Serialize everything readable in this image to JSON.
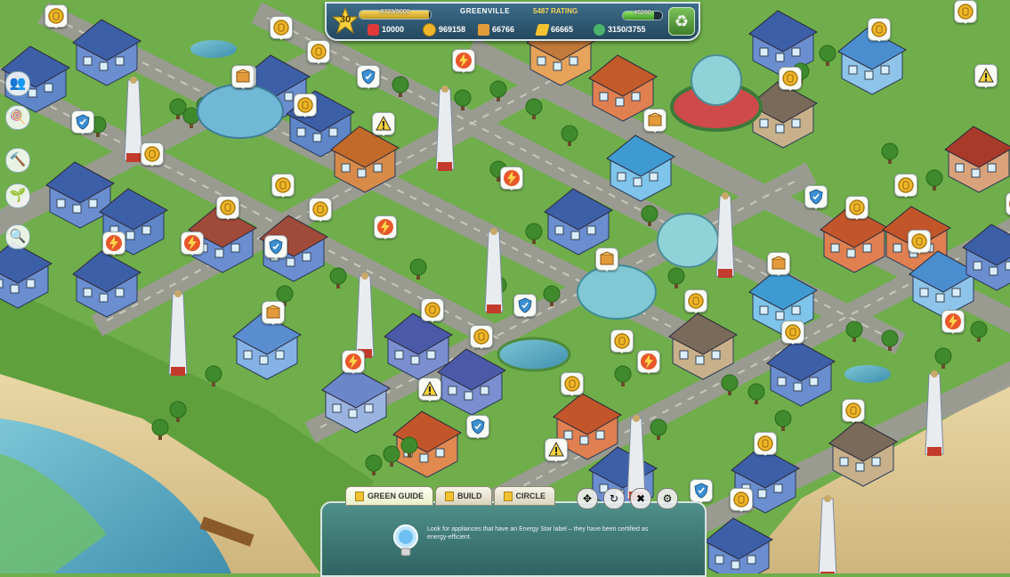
{
  "hud": {
    "level": "30",
    "xp_text": "8723/9000",
    "xp_progress": 0.97,
    "city_name": "GREENVILLE",
    "rating_text": "5487 RATING",
    "eco_points": "46280",
    "eco_progress": 0.8,
    "health": "10000",
    "coins": "969158",
    "materials": "66766",
    "energy": "66665",
    "water": "3150/3755"
  },
  "tabs": [
    {
      "label": "GREEN GUIDE",
      "active": true
    },
    {
      "label": "BUILD",
      "active": false
    },
    {
      "label": "CIRCLE",
      "active": false
    }
  ],
  "tip": {
    "text": "Look for appliances that have an Energy Star label – they have been certified as energy-efficient.",
    "icon": "lightbulb-icon"
  },
  "colors": {
    "grass": "#6fae4a",
    "road": "#9a9a92",
    "water": "#5aa7c0",
    "hud": "#2e5a73",
    "panel": "#3f7c78",
    "coin": "#f0b62a",
    "energy": "#e8572a",
    "shield": "#3c8fd1"
  },
  "bubbles": [
    {
      "type": "coin"
    },
    {
      "type": "coin"
    },
    {
      "type": "coin"
    },
    {
      "type": "coin"
    },
    {
      "type": "coin"
    },
    {
      "type": "coin"
    },
    {
      "type": "coin"
    },
    {
      "type": "coin"
    },
    {
      "type": "coin"
    },
    {
      "type": "coin"
    },
    {
      "type": "coin"
    },
    {
      "type": "coin"
    },
    {
      "type": "coin"
    },
    {
      "type": "coin"
    },
    {
      "type": "coin"
    },
    {
      "type": "coin"
    },
    {
      "type": "coin"
    },
    {
      "type": "coin"
    },
    {
      "type": "coin"
    },
    {
      "type": "coin"
    },
    {
      "type": "coin"
    },
    {
      "type": "coin"
    },
    {
      "type": "coin"
    },
    {
      "type": "coin"
    },
    {
      "type": "energy"
    },
    {
      "type": "energy"
    },
    {
      "type": "energy"
    },
    {
      "type": "energy"
    },
    {
      "type": "energy"
    },
    {
      "type": "energy"
    },
    {
      "type": "energy"
    },
    {
      "type": "energy"
    },
    {
      "type": "energy"
    },
    {
      "type": "shield"
    },
    {
      "type": "shield"
    },
    {
      "type": "shield"
    },
    {
      "type": "shield"
    },
    {
      "type": "shield"
    },
    {
      "type": "shield"
    },
    {
      "type": "shield"
    },
    {
      "type": "crate"
    },
    {
      "type": "crate"
    },
    {
      "type": "crate"
    },
    {
      "type": "crate"
    },
    {
      "type": "crate"
    },
    {
      "type": "warning"
    },
    {
      "type": "warning"
    },
    {
      "type": "warning"
    },
    {
      "type": "warning"
    }
  ]
}
